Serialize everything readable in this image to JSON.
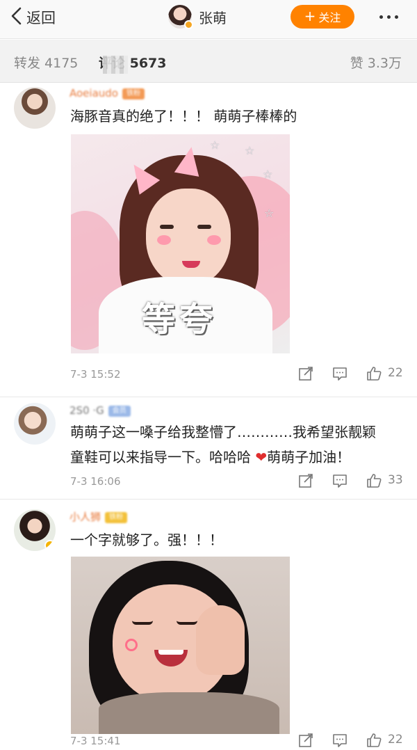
{
  "nav": {
    "back_label": "返回",
    "title": "张萌",
    "follow_label": "关注"
  },
  "stats": {
    "repost": "转发 4175",
    "comments": "评论 5673",
    "likes": "赞 3.3万"
  },
  "comments": [
    {
      "text": "海豚音真的绝了！！！ 萌萌子棒棒的",
      "image_caption": "等夸",
      "time": "7-3 15:52",
      "likes": "22"
    },
    {
      "text_line1": "萌萌子这一嗓子给我整懵了…………我希望张靓颖",
      "text_line2_a": "童鞋可以来指导一下。哈哈哈 ",
      "heart": "❤",
      "text_line2_b": "萌萌子加油！",
      "time": "7-3 16:06",
      "likes": "33"
    },
    {
      "name": "小人狮",
      "text": "一个字就够了。强！！！",
      "time": "7-3 15:41",
      "likes": "22"
    }
  ],
  "colors": {
    "follow": "#ff8200",
    "name": "#e8793b",
    "heart": "#e02e2e"
  }
}
